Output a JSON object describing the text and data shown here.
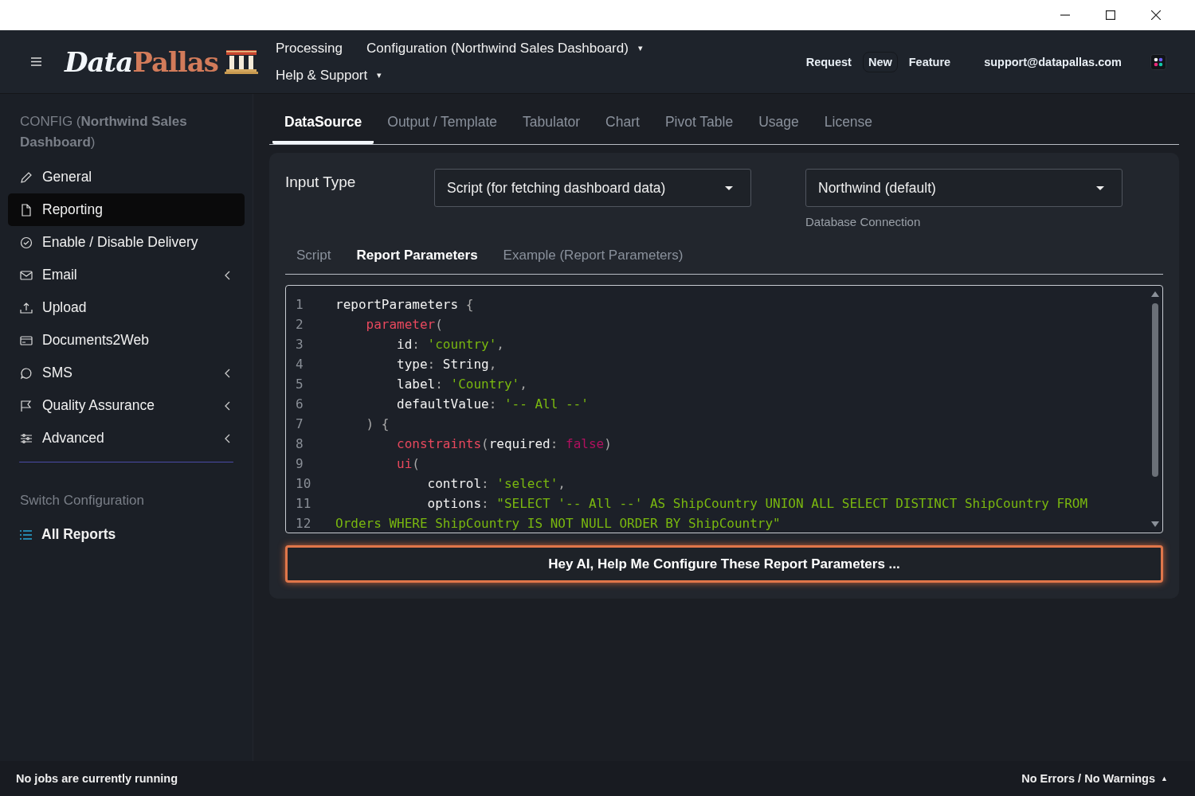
{
  "header": {
    "logo": {
      "first": "Data",
      "second": "Pallas"
    },
    "menus": [
      {
        "label": "Processing"
      },
      {
        "label": "Configuration (Northwind Sales Dashboard)",
        "caret": "▾"
      },
      {
        "label": "Help & Support",
        "caret": "▾"
      }
    ],
    "links": [
      {
        "label": "Request",
        "boxed": false
      },
      {
        "label": "New",
        "boxed": true
      },
      {
        "label": "Feature",
        "boxed": false
      }
    ],
    "email": "support@datapallas.com"
  },
  "sidebar": {
    "title": "CONFIG (**Northwind Sales Dashboard**)",
    "items": [
      {
        "label": "General",
        "selected": false,
        "submenu": false
      },
      {
        "label": "Reporting",
        "selected": true,
        "submenu": false
      },
      {
        "label": "Enable / Disable Delivery",
        "selected": false,
        "submenu": false
      },
      {
        "label": "Email",
        "selected": false,
        "submenu": true
      },
      {
        "label": "Upload",
        "selected": false,
        "submenu": false
      },
      {
        "label": "Documents2Web",
        "selected": false,
        "submenu": false
      },
      {
        "label": "SMS",
        "selected": false,
        "submenu": true
      },
      {
        "label": "Quality Assurance",
        "selected": false,
        "submenu": true
      },
      {
        "label": "Advanced",
        "selected": false,
        "submenu": true
      }
    ],
    "switch_heading": "Switch Configuration",
    "all_reports": "All Reports"
  },
  "tabs": [
    {
      "label": "DataSource",
      "selected": true
    },
    {
      "label": "Output / Template",
      "selected": false
    },
    {
      "label": "Tabulator",
      "selected": false
    },
    {
      "label": "Chart",
      "selected": false
    },
    {
      "label": "Pivot Table",
      "selected": false
    },
    {
      "label": "Usage",
      "selected": false
    },
    {
      "label": "License",
      "selected": false
    }
  ],
  "input_type": {
    "label": "Input Type",
    "value": "Script (for fetching dashboard data)"
  },
  "connection": {
    "value": "Northwind (default)",
    "caption": "Database Connection"
  },
  "subtabs": [
    {
      "label": "Script",
      "selected": false
    },
    {
      "label": "Report Parameters",
      "selected": true
    },
    {
      "label": "Example (Report Parameters)",
      "selected": false
    }
  ],
  "code": [
    {
      "number": "1",
      "tokens": [
        {
          "kind": "plain",
          "text": "reportParameters "
        },
        {
          "kind": "punct",
          "text": "{"
        }
      ]
    },
    {
      "number": "2",
      "tokens": [
        {
          "kind": "key",
          "text": "    parameter"
        },
        {
          "kind": "punct",
          "text": "("
        }
      ]
    },
    {
      "number": "3",
      "tokens": [
        {
          "kind": "plain",
          "text": "        id"
        },
        {
          "kind": "punct",
          "text": ": "
        },
        {
          "kind": "str",
          "text": "'country'"
        },
        {
          "kind": "punct",
          "text": ","
        }
      ]
    },
    {
      "number": "4",
      "tokens": [
        {
          "kind": "plain",
          "text": "        type"
        },
        {
          "kind": "punct",
          "text": ": "
        },
        {
          "kind": "plain",
          "text": "String"
        },
        {
          "kind": "punct",
          "text": ","
        }
      ]
    },
    {
      "number": "5",
      "tokens": [
        {
          "kind": "plain",
          "text": "        label"
        },
        {
          "kind": "punct",
          "text": ": "
        },
        {
          "kind": "str",
          "text": "'Country'"
        },
        {
          "kind": "punct",
          "text": ","
        }
      ]
    },
    {
      "number": "6",
      "tokens": [
        {
          "kind": "plain",
          "text": "        defaultValue"
        },
        {
          "kind": "punct",
          "text": ": "
        },
        {
          "kind": "str",
          "text": "'-- All --'"
        }
      ]
    },
    {
      "number": "7",
      "tokens": [
        {
          "kind": "punct",
          "text": "    ) {"
        }
      ]
    },
    {
      "number": "8",
      "tokens": [
        {
          "kind": "key",
          "text": "        constraints"
        },
        {
          "kind": "punct",
          "text": "("
        },
        {
          "kind": "plain",
          "text": "required"
        },
        {
          "kind": "punct",
          "text": ": "
        },
        {
          "kind": "bool",
          "text": "false"
        },
        {
          "kind": "punct",
          "text": ")"
        }
      ]
    },
    {
      "number": "9",
      "tokens": [
        {
          "kind": "key",
          "text": "        ui"
        },
        {
          "kind": "punct",
          "text": "("
        }
      ]
    },
    {
      "number": "10",
      "tokens": [
        {
          "kind": "plain",
          "text": "            control"
        },
        {
          "kind": "punct",
          "text": ": "
        },
        {
          "kind": "str",
          "text": "'select'"
        },
        {
          "kind": "punct",
          "text": ","
        }
      ]
    },
    {
      "number": "11",
      "tokens": [
        {
          "kind": "plain",
          "text": "            options"
        },
        {
          "kind": "punct",
          "text": ": "
        },
        {
          "kind": "str",
          "text": "\"SELECT '-- All --' AS ShipCountry UNION ALL SELECT DISTINCT ShipCountry FROM"
        }
      ]
    },
    {
      "number": "12",
      "tokens": [
        {
          "kind": "str",
          "text": "Orders WHERE ShipCountry IS NOT NULL ORDER BY ShipCountry\""
        }
      ]
    }
  ],
  "ai_button": "Hey AI, Help Me Configure These Report Parameters ...",
  "status_bar": {
    "left": "No jobs are currently running",
    "right": "No Errors / No Warnings",
    "caret": "▲"
  }
}
